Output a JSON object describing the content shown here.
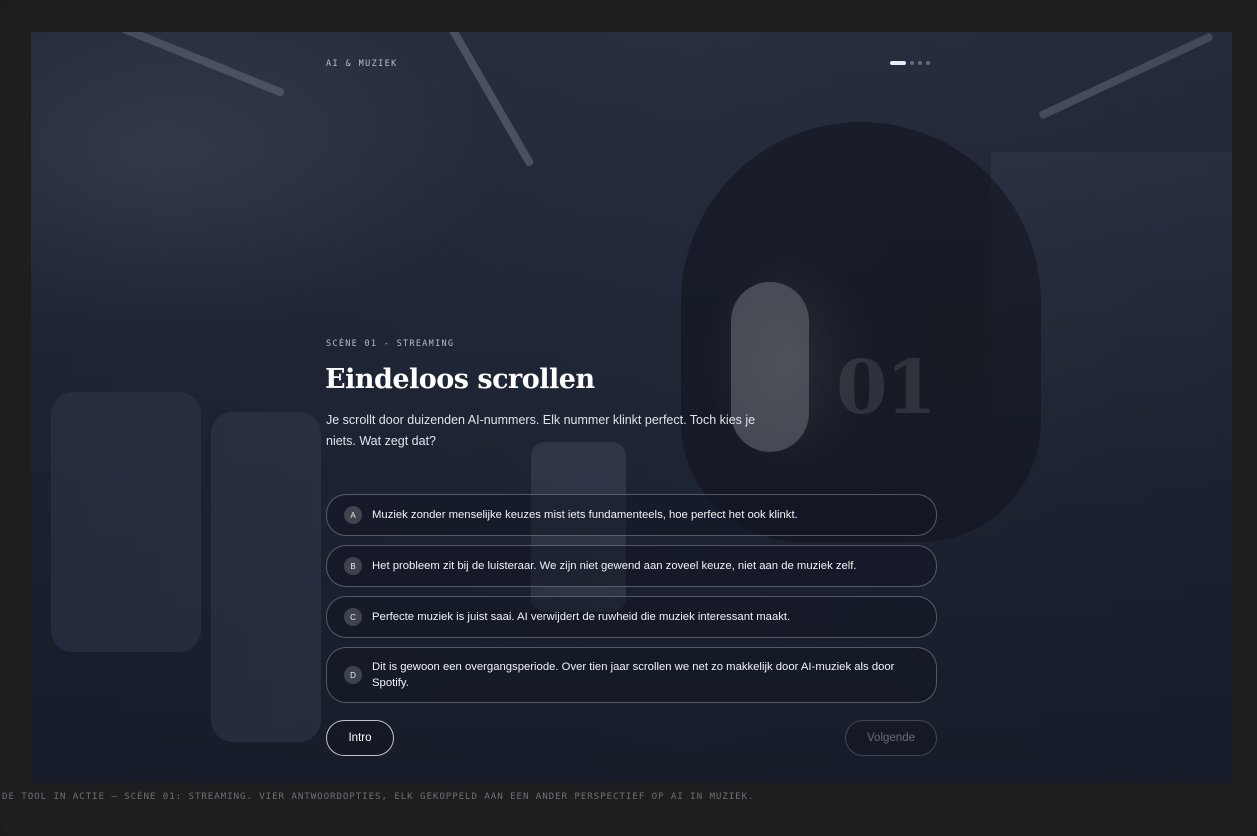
{
  "topbar": {
    "title": "AI & MUZIEK"
  },
  "progress": {
    "total": 4,
    "current": 1
  },
  "scene": {
    "label": "SCÈNE 01 - STREAMING",
    "number": "01",
    "title": "Eindeloos scrollen",
    "text": "Je scrollt door duizenden AI-nummers. Elk nummer klinkt perfect. Toch kies je niets. Wat zegt dat?"
  },
  "options": [
    {
      "letter": "A",
      "text": "Muziek zonder menselijke keuzes mist iets fundamenteels, hoe perfect het ook klinkt."
    },
    {
      "letter": "B",
      "text": "Het probleem zit bij de luisteraar. We zijn niet gewend aan zoveel keuze, niet aan de muziek zelf."
    },
    {
      "letter": "C",
      "text": "Perfecte muziek is juist saai. AI verwijdert de ruwheid die muziek interessant maakt."
    },
    {
      "letter": "D",
      "text": "Dit is gewoon een overgangsperiode. Over tien jaar scrollen we net zo makkelijk door AI-muziek als door Spotify."
    }
  ],
  "nav": {
    "back_label": "Intro",
    "next_label": "Volgende"
  },
  "caption": "DE TOOL IN ACTIE — SCÈNE 01: STREAMING. VIER ANTWOORDOPTIES, ELK GEKOPPELD AAN EEN ANDER PERSPECTIEF OP AI IN MUZIEK."
}
